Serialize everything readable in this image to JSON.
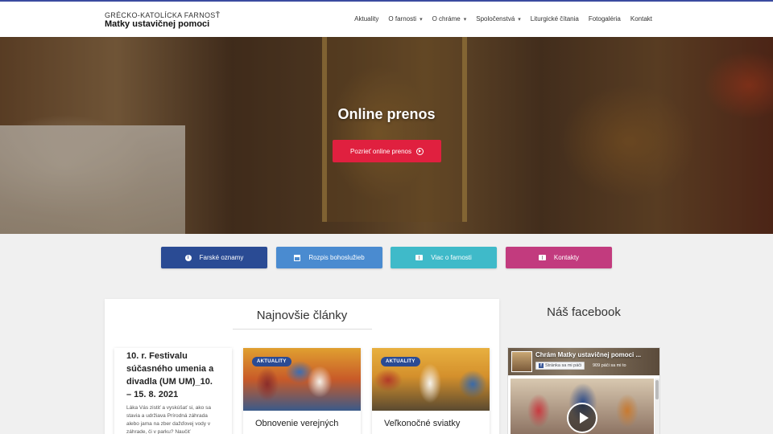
{
  "header": {
    "logo_line1": "GRÉCKO-KATOLÍCKA FARNOSŤ",
    "logo_line2": "Matky ustavičnej pomoci",
    "nav": [
      {
        "label": "Aktuality",
        "has_dropdown": false
      },
      {
        "label": "O farnosti",
        "has_dropdown": true
      },
      {
        "label": "O chráme",
        "has_dropdown": true
      },
      {
        "label": "Spoločenstvá",
        "has_dropdown": true
      },
      {
        "label": "Liturgické čítania",
        "has_dropdown": false
      },
      {
        "label": "Fotogaléria",
        "has_dropdown": false
      },
      {
        "label": "Kontakt",
        "has_dropdown": false
      }
    ]
  },
  "hero": {
    "title": "Online prenos",
    "button_label": "Pozrieť online prenos"
  },
  "quick_links": [
    {
      "label": "Farské oznamy",
      "icon": "info-icon",
      "color": "#2a4b94"
    },
    {
      "label": "Rozpis bohoslužieb",
      "icon": "calendar-icon",
      "color": "#4a8bd0"
    },
    {
      "label": "Viac o farnosti",
      "icon": "book-icon",
      "color": "#3fbac9"
    },
    {
      "label": "Kontakty",
      "icon": "book-icon",
      "color": "#c23b7e"
    }
  ],
  "articles": {
    "heading": "Najnovšie články",
    "items": [
      {
        "title": "10. r. Festivalu súčasného umenia a divadla (UM UM)_10. – 15. 8. 2021",
        "excerpt": "Láka Vás zistiť a vyskúšať si, ako sa stavia a udržiava Prírodná záhrada alebo jama na zber dažďovej vody v záhrade, či v parku? Naučiť"
      },
      {
        "badge": "AKTUALITY",
        "title": "Obnovenie verejných"
      },
      {
        "badge": "AKTUALITY",
        "title": "Veľkonočné sviatky"
      }
    ]
  },
  "facebook": {
    "heading": "Náš facebook",
    "page_name": "Chrám Matky ustavičnej pomoci ...",
    "like_label": "Stránka sa mi páči",
    "likes_text": "909 páči sa mi to"
  },
  "colors": {
    "accent_red": "#e0203f",
    "navy": "#2a4b94",
    "blue": "#4a8bd0",
    "teal": "#3fbac9",
    "magenta": "#c23b7e"
  }
}
